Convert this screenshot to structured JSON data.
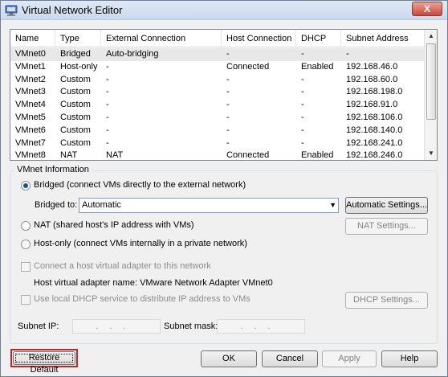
{
  "window": {
    "title": "Virtual Network Editor",
    "close_label": "X"
  },
  "table": {
    "columns": [
      "Name",
      "Type",
      "External Connection",
      "Host Connection",
      "DHCP",
      "Subnet Address"
    ],
    "rows": [
      [
        "VMnet0",
        "Bridged",
        "Auto-bridging",
        "-",
        "-",
        "-"
      ],
      [
        "VMnet1",
        "Host-only",
        "-",
        "Connected",
        "Enabled",
        "192.168.46.0"
      ],
      [
        "VMnet2",
        "Custom",
        "-",
        "-",
        "-",
        "192.168.60.0"
      ],
      [
        "VMnet3",
        "Custom",
        "-",
        "-",
        "-",
        "192.168.198.0"
      ],
      [
        "VMnet4",
        "Custom",
        "-",
        "-",
        "-",
        "192.168.91.0"
      ],
      [
        "VMnet5",
        "Custom",
        "-",
        "-",
        "-",
        "192.168.106.0"
      ],
      [
        "VMnet6",
        "Custom",
        "-",
        "-",
        "-",
        "192.168.140.0"
      ],
      [
        "VMnet7",
        "Custom",
        "-",
        "-",
        "-",
        "192.168.241.0"
      ],
      [
        "VMnet8",
        "NAT",
        "NAT",
        "Connected",
        "Enabled",
        "192.168.246.0"
      ]
    ],
    "selected_row": 0
  },
  "vmnet_info": {
    "title": "VMnet Information",
    "bridged_label": "Bridged (connect VMs directly to the external network)",
    "bridged_to_label": "Bridged to:",
    "bridged_to_value": "Automatic",
    "auto_settings_label": "Automatic Settings...",
    "nat_label": "NAT (shared host's IP address with VMs)",
    "nat_settings_label": "NAT Settings...",
    "hostonly_label": "Host-only (connect VMs internally in a private network)",
    "connect_adapter_label": "Connect a host virtual adapter to this network",
    "adapter_name_label": "Host virtual adapter name: VMware Network Adapter VMnet0",
    "dhcp_label": "Use local DHCP service to distribute IP address to VMs",
    "dhcp_settings_label": "DHCP Settings...",
    "subnet_ip_label": "Subnet IP:",
    "subnet_ip_value": "...",
    "subnet_mask_label": "Subnet mask:",
    "subnet_mask_value": "...",
    "selected_mode": "bridged"
  },
  "buttons": {
    "restore_default": "Restore Default",
    "ok": "OK",
    "cancel": "Cancel",
    "apply": "Apply",
    "help": "Help"
  },
  "colors": {
    "highlight_box": "#c8232c",
    "selected_radio": "#1a4f9c"
  }
}
